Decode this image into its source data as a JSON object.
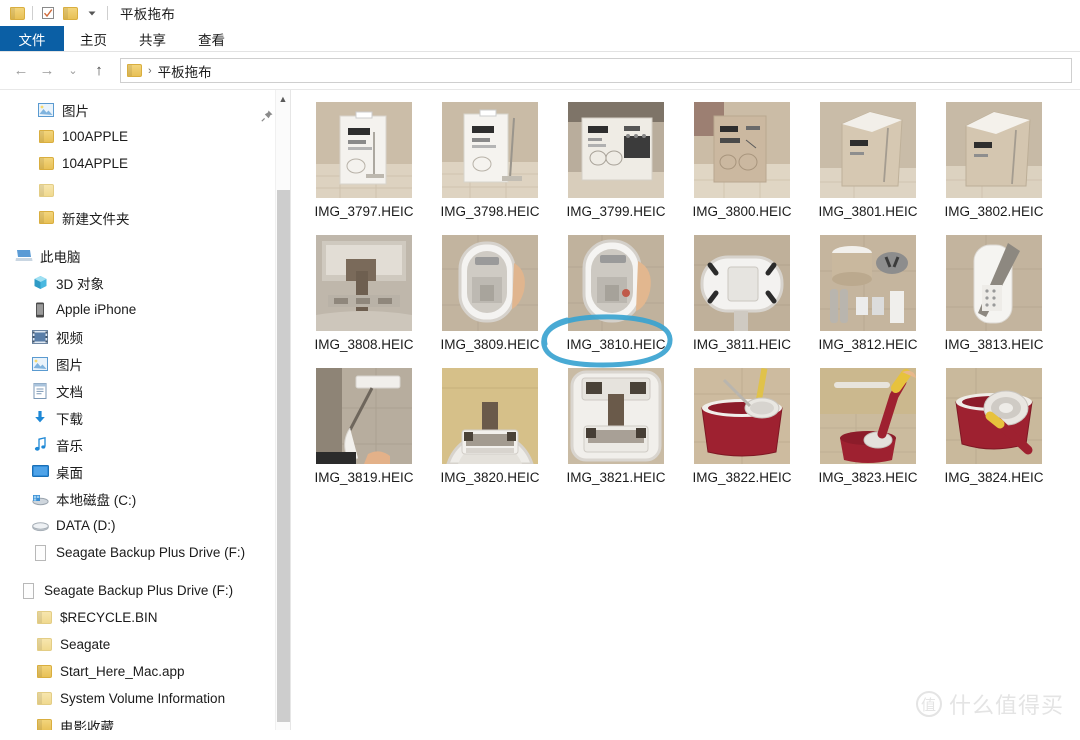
{
  "window": {
    "title": "平板拖布",
    "quick_access": [
      {
        "name": "folder-icon",
        "label": "平板拖布"
      },
      {
        "name": "properties-icon",
        "label": "属性"
      },
      {
        "name": "new-folder-icon",
        "label": "新建文件夹"
      },
      {
        "name": "customize-dropdown-icon",
        "label": "自定义快速访问工具栏"
      }
    ]
  },
  "ribbon": {
    "tabs": [
      {
        "label": "文件",
        "active": true
      },
      {
        "label": "主页",
        "active": false
      },
      {
        "label": "共享",
        "active": false
      },
      {
        "label": "查看",
        "active": false
      }
    ]
  },
  "navigation": {
    "back_label": "←",
    "forward_label": "→",
    "recent_label": "⌄",
    "up_label": "↑",
    "breadcrumb": {
      "separator": "›",
      "path": "平板拖布"
    }
  },
  "sidebar": {
    "groups": [
      {
        "header": {
          "label": "图片",
          "icon": "pictures-icon",
          "indent": 1,
          "pinned": true
        },
        "items": [
          {
            "label": "100APPLE",
            "icon": "folder-icon",
            "indent": 2
          },
          {
            "label": "104APPLE",
            "icon": "folder-icon",
            "indent": 2
          },
          {
            "label": "",
            "icon": "folder-icon",
            "indent": 2
          },
          {
            "label": "新建文件夹",
            "icon": "folder-icon",
            "indent": 2
          }
        ]
      },
      {
        "header": {
          "label": "此电脑",
          "icon": "this-pc-icon",
          "indent": 0
        },
        "items": [
          {
            "label": "3D 对象",
            "icon": "3d-objects-icon",
            "indent": 1
          },
          {
            "label": "Apple iPhone",
            "icon": "iphone-icon",
            "indent": 1
          },
          {
            "label": "视频",
            "icon": "videos-icon",
            "indent": 1
          },
          {
            "label": "图片",
            "icon": "pictures-icon",
            "indent": 1
          },
          {
            "label": "文档",
            "icon": "documents-icon",
            "indent": 1
          },
          {
            "label": "下载",
            "icon": "downloads-icon",
            "indent": 1
          },
          {
            "label": "音乐",
            "icon": "music-icon",
            "indent": 1
          },
          {
            "label": "桌面",
            "icon": "desktop-icon",
            "indent": 1
          },
          {
            "label": "本地磁盘 (C:)",
            "icon": "system-drive-icon",
            "indent": 1
          },
          {
            "label": "DATA (D:)",
            "icon": "drive-icon",
            "indent": 1
          },
          {
            "label": "Seagate Backup Plus Drive (F:)",
            "icon": "external-drive-icon",
            "indent": 1
          }
        ]
      },
      {
        "header": {
          "label": "Seagate Backup Plus Drive (F:)",
          "icon": "external-drive-icon",
          "indent": 0
        },
        "items": [
          {
            "label": "$RECYCLE.BIN",
            "icon": "folder-icon-pale",
            "indent": 1
          },
          {
            "label": "Seagate",
            "icon": "folder-icon-pale",
            "indent": 1
          },
          {
            "label": "Start_Here_Mac.app",
            "icon": "folder-icon",
            "indent": 1
          },
          {
            "label": "System Volume Information",
            "icon": "folder-icon-pale",
            "indent": 1
          },
          {
            "label": "电影收藏",
            "icon": "folder-icon",
            "indent": 1
          }
        ]
      }
    ]
  },
  "files": {
    "items": [
      {
        "name": "IMG_3797.HEIC",
        "subject": "white-mop-box-front"
      },
      {
        "name": "IMG_3798.HEIC",
        "subject": "white-mop-box-front-angle"
      },
      {
        "name": "IMG_3799.HEIC",
        "subject": "mop-box-open-top"
      },
      {
        "name": "IMG_3800.HEIC",
        "subject": "mop-box-side-panel"
      },
      {
        "name": "IMG_3801.HEIC",
        "subject": "mop-box-opened"
      },
      {
        "name": "IMG_3802.HEIC",
        "subject": "mop-box-opened-2"
      },
      {
        "name": "IMG_3808.HEIC",
        "subject": "bucket-interior-mechanism"
      },
      {
        "name": "IMG_3809.HEIC",
        "subject": "bucket-top-view-hand"
      },
      {
        "name": "IMG_3810.HEIC",
        "subject": "bucket-top-view-hand-2",
        "annotated": true
      },
      {
        "name": "IMG_3811.HEIC",
        "subject": "bucket-lid-closed"
      },
      {
        "name": "IMG_3812.HEIC",
        "subject": "parts-laid-out"
      },
      {
        "name": "IMG_3813.HEIC",
        "subject": "flat-mop-head"
      },
      {
        "name": "IMG_3819.HEIC",
        "subject": "mop-held-in-hand"
      },
      {
        "name": "IMG_3820.HEIC",
        "subject": "wringer-closeup"
      },
      {
        "name": "IMG_3821.HEIC",
        "subject": "wringer-closeup-2"
      },
      {
        "name": "IMG_3822.HEIC",
        "subject": "red-spin-bucket"
      },
      {
        "name": "IMG_3823.HEIC",
        "subject": "spin-mop-in-bucket"
      },
      {
        "name": "IMG_3824.HEIC",
        "subject": "spin-mop-basket-top"
      }
    ],
    "annotation": {
      "target": "IMG_3810.HEIC",
      "shape": "hand-drawn-ellipse",
      "color": "#3aa3d0"
    }
  },
  "watermark": {
    "badge": "值",
    "text": "什么值得买"
  },
  "colors": {
    "file_tab_blue": "#0b5fa5",
    "annotation_blue": "#3aa3d0",
    "folder_yellow": "#e8c056"
  }
}
